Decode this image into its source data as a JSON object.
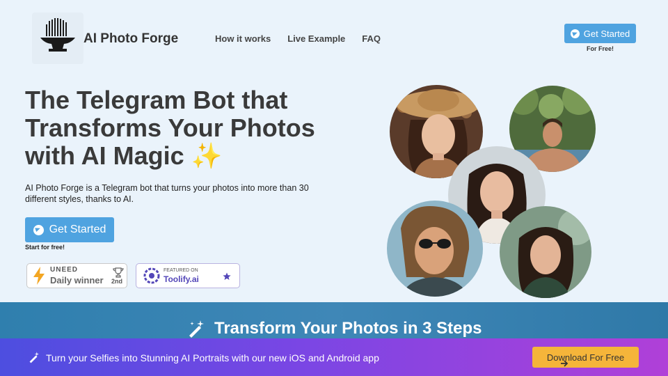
{
  "header": {
    "brand": "AI Photo Forge",
    "nav": [
      "How it works",
      "Live Example",
      "FAQ"
    ],
    "cta_label": "Get Started",
    "cta_sub": "For Free!"
  },
  "hero": {
    "title": "The Telegram Bot that Transforms Your Photos with AI Magic ✨",
    "description": "AI Photo Forge is a Telegram bot that turns your photos into more than 30 different styles, thanks to AI.",
    "cta_label": "Get Started",
    "cta_sub": "Start for free!"
  },
  "badges": {
    "uneed": {
      "brand": "UNEED",
      "label": "Daily winner",
      "rank": "2nd"
    },
    "toolify": {
      "small": "FEATURED ON",
      "label": "Toolify.ai"
    }
  },
  "steps": {
    "title": "Transform Your Photos in 3 Steps"
  },
  "promo": {
    "text": "Turn your Selfies into Stunning AI Portraits with our new iOS and Android app",
    "button": "Download For Free"
  },
  "colors": {
    "accent": "#4fa3e0",
    "steps_band": "#3a82b3",
    "promo_from": "#4d4ee0",
    "promo_to": "#b040d8",
    "download": "#f5b53a"
  },
  "icons": [
    "telegram-icon",
    "trophy-icon",
    "star-icon",
    "magic-wand-icon",
    "arrow-right-icon",
    "lightning-icon"
  ]
}
